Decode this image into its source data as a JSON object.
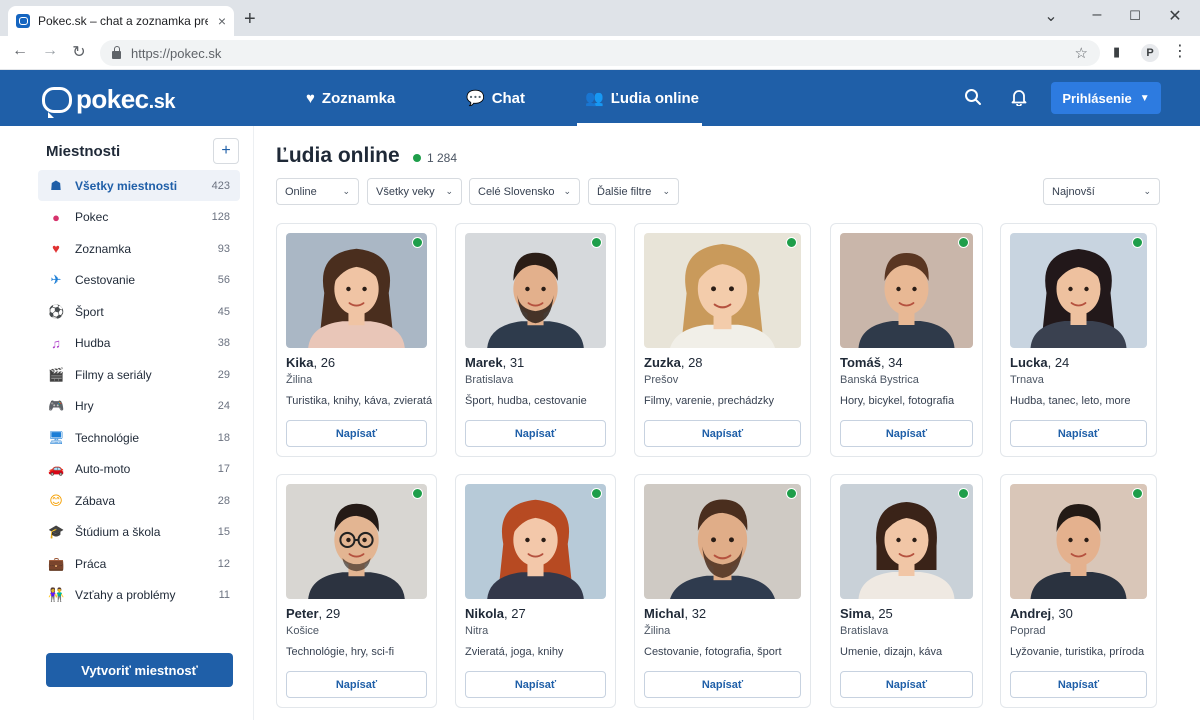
{
  "browser": {
    "tab_title": "Pokec.sk – chat a zoznamka pre k",
    "tab_close": "×",
    "new_tab": "+",
    "url": "https://pokec.sk",
    "profile_initial": "P"
  },
  "header": {
    "logo_text": "pokec",
    "logo_domain": ".sk",
    "nav": [
      {
        "label": "Zoznamka",
        "icon": "heart-icon",
        "active": false
      },
      {
        "label": "Chat",
        "icon": "chat-bubble-icon",
        "active": false
      },
      {
        "label": "Ľudia online",
        "icon": "people-icon",
        "active": true
      }
    ],
    "login_label": "Prihlásenie"
  },
  "sidebar": {
    "title": "Miestnosti",
    "add_label": "+",
    "rooms": [
      {
        "label": "Všetky miestnosti",
        "count": "423",
        "icon": "rooms-icon",
        "active": true
      },
      {
        "label": "Pokec",
        "count": "128",
        "icon": "chat-icon"
      },
      {
        "label": "Zoznamka",
        "count": "93",
        "icon": "heart-icon"
      },
      {
        "label": "Cestovanie",
        "count": "56",
        "icon": "airplane-icon"
      },
      {
        "label": "Šport",
        "count": "45",
        "icon": "soccer-ball-icon"
      },
      {
        "label": "Hudba",
        "count": "38",
        "icon": "music-note-icon"
      },
      {
        "label": "Filmy a seriály",
        "count": "29",
        "icon": "clapperboard-icon"
      },
      {
        "label": "Hry",
        "count": "24",
        "icon": "gamepad-icon"
      },
      {
        "label": "Technológie",
        "count": "18",
        "icon": "monitor-icon"
      },
      {
        "label": "Auto-moto",
        "count": "17",
        "icon": "car-icon"
      },
      {
        "label": "Zábava",
        "count": "28",
        "icon": "smiley-icon"
      },
      {
        "label": "Štúdium a škola",
        "count": "15",
        "icon": "graduation-cap-icon"
      },
      {
        "label": "Práca",
        "count": "12",
        "icon": "briefcase-icon"
      },
      {
        "label": "Vzťahy a problémy",
        "count": "11",
        "icon": "couple-icon"
      }
    ],
    "create_label": "Vytvoriť miestnosť"
  },
  "main": {
    "title": "Ľudia online",
    "online_count": "1 284",
    "filters": [
      {
        "label": "Online"
      },
      {
        "label": "Všetky veky"
      },
      {
        "label": "Celé Slovensko"
      },
      {
        "label": "Ďalšie filtre"
      }
    ],
    "sort_label": "Najnovší",
    "write_label": "Napísať",
    "people": [
      {
        "name": "Kika",
        "age": "26",
        "city": "Žilina",
        "interests": "Turistika, knihy, káva, zvieratá",
        "gender": "f",
        "hair": "#4a2e1e",
        "skin": "#f0c4a4",
        "shirt": "#e9c6b8",
        "bg": "#aab7c5",
        "style": "long"
      },
      {
        "name": "Marek",
        "age": "31",
        "city": "Bratislava",
        "interests": "Šport, hudba, cestovanie",
        "gender": "m",
        "hair": "#2a1d16",
        "skin": "#e3b08c",
        "shirt": "#2e3b4c",
        "bg": "#d6d9dc",
        "style": "beard"
      },
      {
        "name": "Zuzka",
        "age": "28",
        "city": "Prešov",
        "interests": "Filmy, varenie, prechádzky",
        "gender": "f",
        "hair": "#c99a5b",
        "skin": "#f3ccab",
        "shirt": "#f1efe8",
        "bg": "#e8e4d8",
        "style": "wavy"
      },
      {
        "name": "Tomáš",
        "age": "34",
        "city": "Banská Bystrica",
        "interests": "Hory, bicykel, fotografia",
        "gender": "m",
        "hair": "#5a3622",
        "skin": "#e8b894",
        "shirt": "#2f3a4a",
        "bg": "#c9b6aa",
        "style": "short"
      },
      {
        "name": "Lucka",
        "age": "24",
        "city": "Trnava",
        "interests": "Hudba, tanec, leto, more",
        "gender": "f",
        "hair": "#22181a",
        "skin": "#eec19f",
        "shirt": "#3a4150",
        "bg": "#c8d4e0",
        "style": "long"
      },
      {
        "name": "Peter",
        "age": "29",
        "city": "Košice",
        "interests": "Technológie, hry, sci-fi",
        "gender": "m",
        "hair": "#241a16",
        "skin": "#e3b592",
        "shirt": "#2c3340",
        "bg": "#d8d6d2",
        "style": "glasses"
      },
      {
        "name": "Nikola",
        "age": "27",
        "city": "Nitra",
        "interests": "Zvieratá, joga, knihy",
        "gender": "f",
        "hair": "#b74a22",
        "skin": "#f3c8aa",
        "shirt": "#33384a",
        "bg": "#b7cad8",
        "style": "wavy"
      },
      {
        "name": "Michal",
        "age": "32",
        "city": "Žilina",
        "interests": "Cestovanie, fotografia, šport",
        "gender": "m",
        "hair": "#4a2e1e",
        "skin": "#e0ad88",
        "shirt": "#2f3b4e",
        "bg": "#cfcac4",
        "style": "beard"
      },
      {
        "name": "Sima",
        "age": "25",
        "city": "Bratislava",
        "interests": "Umenie, dizajn, káva",
        "gender": "f",
        "hair": "#3a2318",
        "skin": "#f1c6a6",
        "shirt": "#efe9e2",
        "bg": "#c9d1d8",
        "style": "bob"
      },
      {
        "name": "Andrej",
        "age": "30",
        "city": "Poprad",
        "interests": "Lyžovanie, turistika, príroda",
        "gender": "m",
        "hair": "#231a15",
        "skin": "#e4b18e",
        "shirt": "#2a323f",
        "bg": "#d9c6b8",
        "style": "short"
      }
    ]
  }
}
